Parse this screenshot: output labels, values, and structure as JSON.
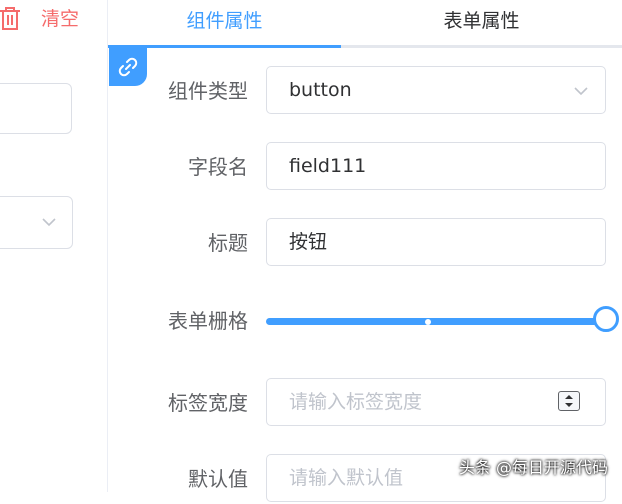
{
  "left_panel": {
    "clear_label": "清空",
    "trash_icon": "trash-icon"
  },
  "tabs": [
    {
      "label": "组件属性",
      "active": true
    },
    {
      "label": "表单属性",
      "active": false
    }
  ],
  "form": {
    "component_type": {
      "label": "组件类型",
      "value": "button"
    },
    "field_name": {
      "label": "字段名",
      "value": "field111"
    },
    "title": {
      "label": "标题",
      "value": "按钮"
    },
    "grid": {
      "label": "表单栅格",
      "value_fraction": 1.0
    },
    "label_width": {
      "label": "标签宽度",
      "placeholder": "请输入标签宽度"
    },
    "default_value": {
      "label": "默认值",
      "placeholder": "请输入默认值"
    }
  },
  "watermark": "头条 @每日开源代码",
  "colors": {
    "accent": "#409eff",
    "danger": "#f56c6c"
  }
}
